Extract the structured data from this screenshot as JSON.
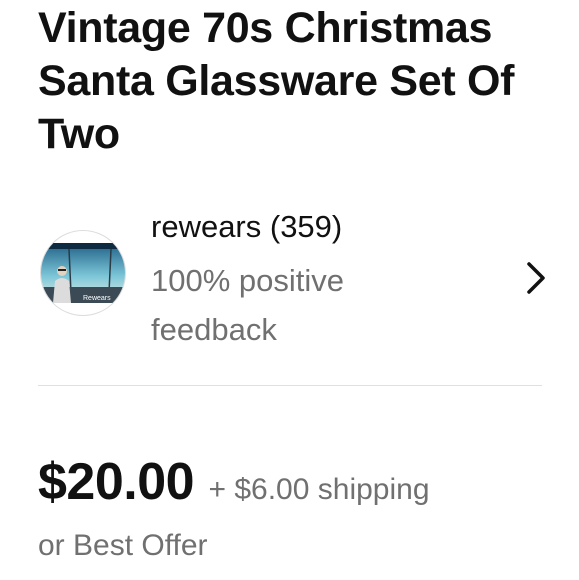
{
  "listing": {
    "title": "Vintage 70s Christmas Santa Glassware Set Of Two"
  },
  "seller": {
    "name_with_count": "rewears (359)",
    "feedback": "100% positive feedback",
    "avatar_caption": "Rewears",
    "chevron_icon": "chevron-right-icon"
  },
  "pricing": {
    "price": "$20.00",
    "shipping": "+ $6.00 shipping",
    "offer_text": "or Best Offer"
  },
  "colors": {
    "text_primary": "#111111",
    "text_secondary": "#707070",
    "divider": "#e0e0e0"
  }
}
